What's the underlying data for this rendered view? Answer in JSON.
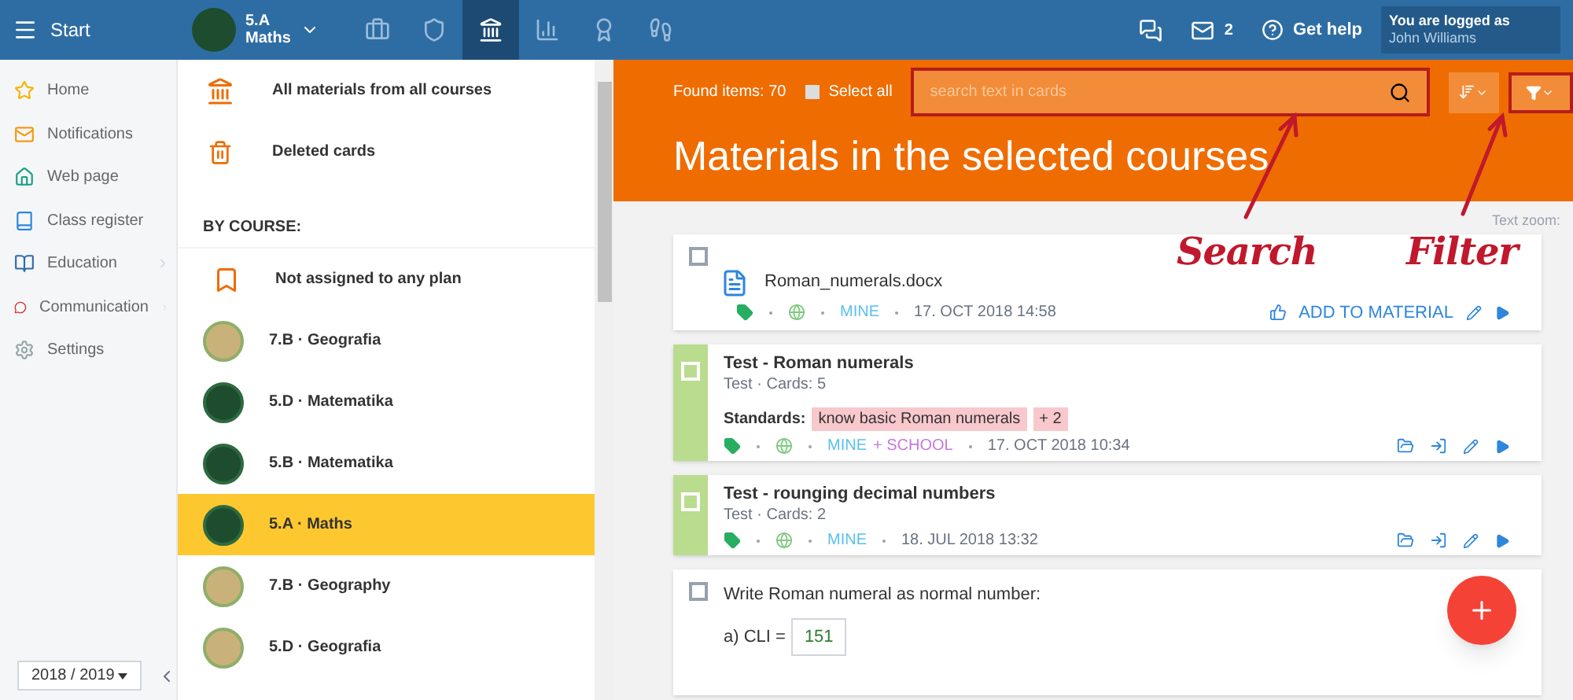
{
  "topbar": {
    "menu_label": "Start",
    "course": {
      "line1": "5.A",
      "line2": "Maths"
    },
    "tabs": [
      {
        "kind": "briefcase",
        "selected": false
      },
      {
        "kind": "shield",
        "selected": false
      },
      {
        "kind": "bank",
        "selected": true
      },
      {
        "kind": "chart",
        "selected": false
      },
      {
        "kind": "badge",
        "selected": false
      },
      {
        "kind": "walk",
        "selected": false
      }
    ],
    "messages_count": "2",
    "help_label": "Get help",
    "user": {
      "caption": "You are logged as",
      "name": "John Williams"
    }
  },
  "sidebar": {
    "items": [
      {
        "kind": "star",
        "label": "Home",
        "has_submenu": false
      },
      {
        "kind": "mail",
        "label": "Notifications",
        "has_submenu": false
      },
      {
        "kind": "home",
        "label": "Web page",
        "has_submenu": false
      },
      {
        "kind": "book",
        "label": "Class register",
        "has_submenu": false
      },
      {
        "kind": "education",
        "label": "Education",
        "has_submenu": true
      },
      {
        "kind": "chat",
        "label": "Communication",
        "has_submenu": true
      },
      {
        "kind": "gear",
        "label": "Settings",
        "has_submenu": false
      }
    ],
    "year": "2018 / 2019"
  },
  "courses_panel": {
    "top_items": [
      {
        "kind": "bank",
        "label": "All materials from all courses"
      },
      {
        "kind": "trash",
        "label": "Deleted cards"
      }
    ],
    "section_title": "BY COURSE:",
    "items": [
      {
        "kind": "bookmark",
        "label": "Not assigned to any plan",
        "selected": false
      },
      {
        "kind": "map",
        "label": "7.B · Geografia",
        "selected": false
      },
      {
        "kind": "chalkboard",
        "label": "5.D · Matematika",
        "selected": false
      },
      {
        "kind": "chalkboard",
        "label": "5.B · Matematika",
        "selected": false
      },
      {
        "kind": "chalkboard",
        "label": "5.A · Maths",
        "selected": true
      },
      {
        "kind": "map",
        "label": "7.B · Geography",
        "selected": false
      },
      {
        "kind": "map",
        "label": "5.D · Geografia",
        "selected": false
      }
    ]
  },
  "main": {
    "found": "Found items: 70",
    "select_all": {
      "label": "Select all",
      "checked": false
    },
    "search": {
      "placeholder": "search text in cards",
      "highlighted": true
    },
    "filter_highlighted": true,
    "title": "Materials in the selected courses",
    "text_zoom": "Text zoom:",
    "annotations": [
      "Search",
      "Filter"
    ],
    "cards": [
      {
        "kind": "file",
        "selected": false,
        "title": "Roman_numerals.docx",
        "tags": [
          {
            "label": "MINE",
            "color": "#5bc0eb"
          }
        ],
        "date": "17. OCT 2018 14:58",
        "action_label": "ADD TO MATERIAL"
      },
      {
        "kind": "test",
        "selected": false,
        "title": "Test - Roman numerals",
        "subtitle": "Test · Cards: 5",
        "standards_label": "Standards:",
        "standards": [
          "know basic Roman numerals",
          "+ 2"
        ],
        "tags": [
          {
            "label": "MINE",
            "color": "#5bc0eb"
          },
          {
            "label": "+ SCHOOL",
            "color": "#c678dd"
          }
        ],
        "date": "17. OCT 2018 10:34"
      },
      {
        "kind": "test",
        "selected": false,
        "title": "Test - rounging decimal numbers",
        "subtitle": "Test · Cards: 2",
        "tags": [
          {
            "label": "MINE",
            "color": "#5bc0eb"
          }
        ],
        "date": "18. JUL 2018 13:32"
      },
      {
        "kind": "question",
        "selected": false,
        "title": "Write Roman numeral as normal number:",
        "answers": [
          {
            "label": "a) CLI =",
            "value": "151"
          }
        ]
      }
    ]
  }
}
